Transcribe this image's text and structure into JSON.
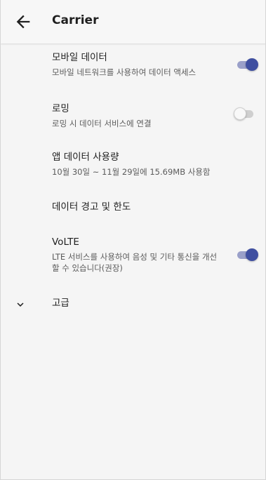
{
  "header": {
    "title": "Carrier",
    "back_icon": "arrow-left-icon"
  },
  "settings": {
    "mobile_data": {
      "title": "모바일 데이터",
      "summary": "모바일 네트워크를 사용하여 데이터 액세스",
      "toggle_on": true
    },
    "roaming": {
      "title": "로밍",
      "summary": "로밍 시 데이터 서비스에 연결",
      "toggle_on": false
    },
    "app_data_usage": {
      "title": "앱 데이터 사용량",
      "summary": "10월 30일 ~ 11월 29일에 15.69MB 사용함"
    },
    "data_warning_limit": {
      "title": "데이터 경고 및 한도"
    },
    "volte": {
      "title": "VoLTE",
      "summary": "LTE 서비스를 사용하여 음성 및 기타 통신을 개선할 수 있습니다(권장)",
      "toggle_on": true
    },
    "advanced": {
      "title": "고급",
      "icon": "chevron-down-icon"
    }
  },
  "colors": {
    "accent": "#3f4fa0",
    "accent_track": "#9aa0c9",
    "background": "#f5f5f5"
  }
}
